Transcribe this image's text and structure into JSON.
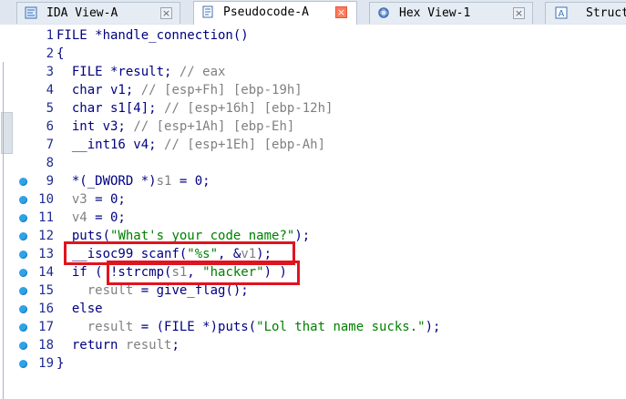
{
  "tabs": [
    {
      "label": "IDA View-A",
      "icon": "ida-view-icon",
      "active": false
    },
    {
      "label": "Pseudocode-A",
      "icon": "pseudocode-icon",
      "active": true
    },
    {
      "label": "Hex View-1",
      "icon": "hex-view-icon",
      "active": false
    },
    {
      "label": "Struct",
      "icon": "structures-icon",
      "active": false
    }
  ],
  "close_glyph": "×",
  "line_numbers": [
    "1",
    "2",
    "3",
    "4",
    "5",
    "6",
    "7",
    "8",
    "9",
    "10",
    "11",
    "12",
    "13",
    "14",
    "15",
    "16",
    "17",
    "18",
    "19"
  ],
  "breakpoint_lines": [
    9,
    10,
    11,
    12,
    13,
    14,
    15,
    16,
    17,
    18,
    19
  ],
  "code": {
    "l1": {
      "text": "FILE *handle_connection()"
    },
    "l2": {
      "text": "{"
    },
    "l3": {
      "type": "FILE *result;",
      "comment": "// eax"
    },
    "l4": {
      "type": "char v1;",
      "comment": "// [esp+Fh] [ebp-19h]"
    },
    "l5": {
      "type": "char s1[4];",
      "comment": "// [esp+16h] [ebp-12h]"
    },
    "l6": {
      "type": "int v3;",
      "comment": "// [esp+1Ah] [ebp-Eh]"
    },
    "l7": {
      "type": "__int16 v4;",
      "comment": "// [esp+1Eh] [ebp-Ah]"
    },
    "l9": {
      "pre": "*(_DWORD *)",
      "var": "s1",
      "post": " = 0;"
    },
    "l10": {
      "var": "v3",
      "post": " = 0;"
    },
    "l11": {
      "var": "v4",
      "post": " = 0;"
    },
    "l12": {
      "pre": "puts(",
      "str": "\"What's your code name?\"",
      "post": ");"
    },
    "l13": {
      "pre": "__isoc99_scanf(",
      "str": "\"%s\"",
      "mid": ", &",
      "var": "v1",
      "post": ");"
    },
    "l14": {
      "pre": "if ( !strcmp(",
      "var": "s1",
      "mid": ", ",
      "str": "\"hacker\"",
      "post": ") )"
    },
    "l15": {
      "var": "result",
      "post": " = give_flag();"
    },
    "l16": {
      "text": "else"
    },
    "l17": {
      "var": "result",
      "pre": " = (FILE *)puts(",
      "str": "\"Lol that name sucks.\"",
      "post": ");"
    },
    "l18": {
      "pre": "return ",
      "var": "result",
      "post": ";"
    },
    "l19": {
      "text": "}"
    }
  },
  "highlight_color": "#e0141e"
}
